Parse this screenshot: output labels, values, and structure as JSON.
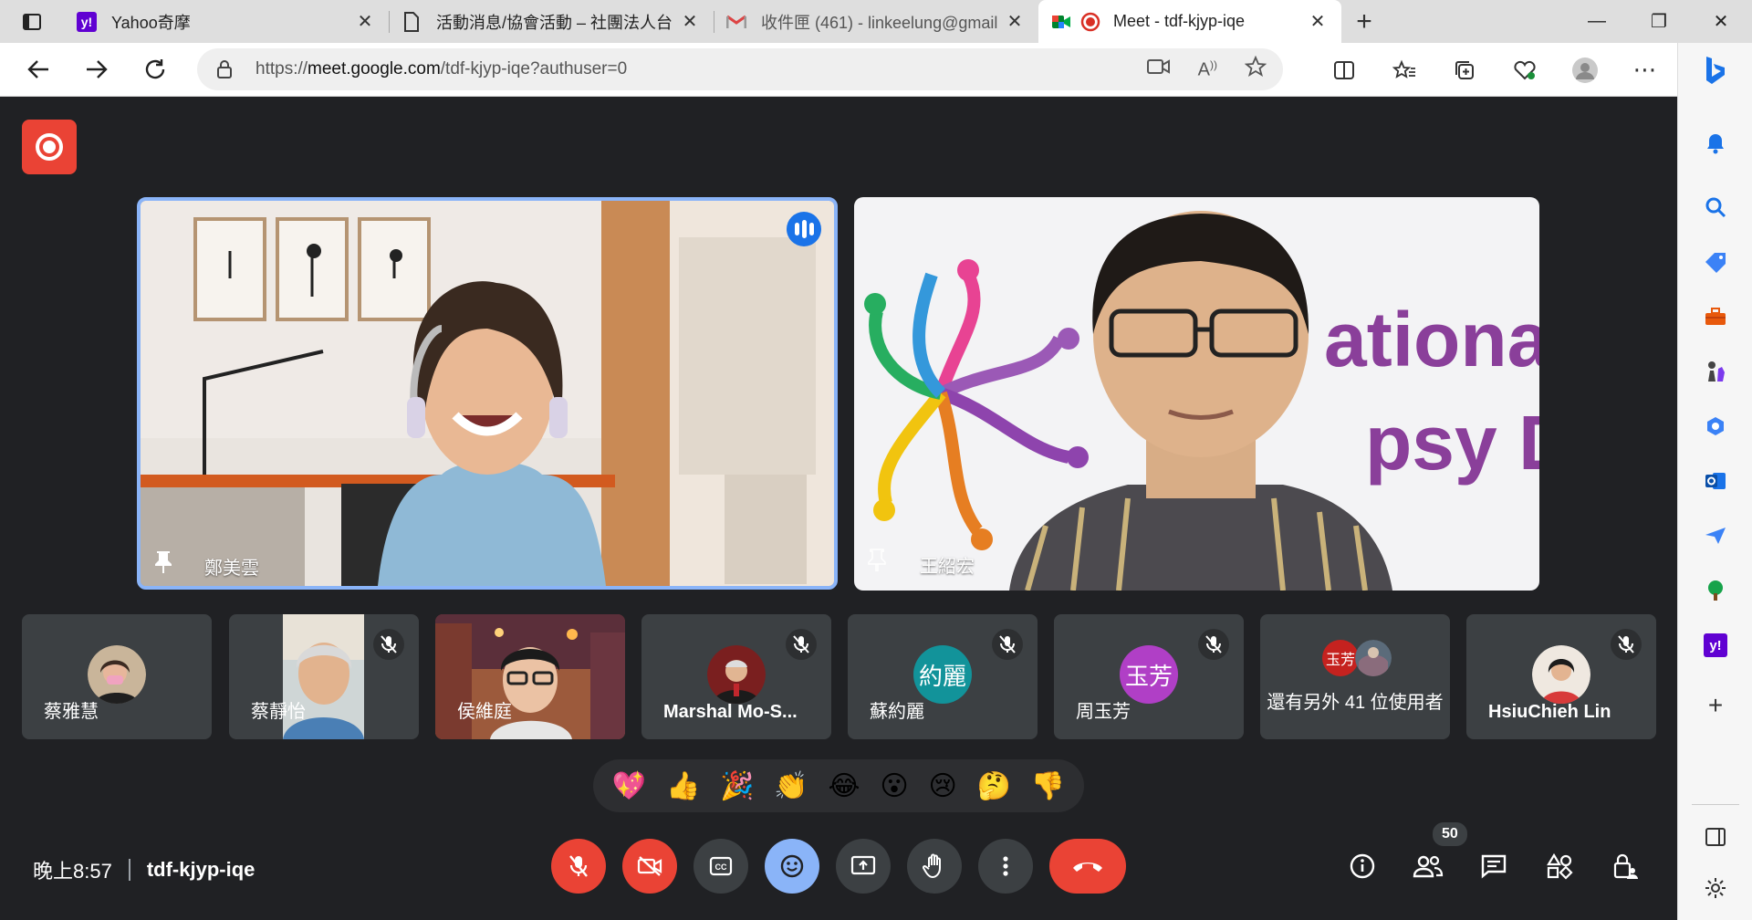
{
  "tabs": [
    {
      "title": "Yahoo奇摩",
      "favicon": "yahoo-icon"
    },
    {
      "title": "活動消息/協會活動 – 社團法人台",
      "favicon": "page-icon"
    },
    {
      "title": "收件匣 (461) - linkeelung@gmail",
      "favicon": "gmail-icon"
    },
    {
      "title": "Meet - tdf-kjyp-iqe",
      "favicon": "meet-icon",
      "active": true
    }
  ],
  "address": {
    "prefix": "https://",
    "host": "meet.google.com",
    "path": "/tdf-kjyp-iqe?authuser=0"
  },
  "meeting": {
    "time": "晚上8:57",
    "code": "tdf-kjyp-iqe",
    "participant_count": "50"
  },
  "main_tiles": [
    {
      "name": "鄭美雲",
      "speaking": true
    },
    {
      "name": "王紹宏",
      "speaking": false,
      "background_text_line1": "ational",
      "background_text_line2": "psy Da"
    }
  ],
  "small_tiles": [
    {
      "name": "蔡雅慧",
      "muted": false
    },
    {
      "name": "蔡靜怡",
      "muted": true
    },
    {
      "name": "侯維庭",
      "muted": false
    },
    {
      "name": "Marshal Mo-S...",
      "muted": true
    },
    {
      "name": "蘇約麗",
      "avatar_text": "約麗",
      "avatar_color": "#12939a",
      "muted": true
    },
    {
      "name": "周玉芳",
      "avatar_text": "玉芳",
      "avatar_color": "#b03fc6",
      "muted": true
    },
    {
      "name": "還有另外 41 位使用者",
      "avatar_text": "玉芳",
      "avatar_color": "#c5221f"
    },
    {
      "name": "HsiuChieh Lin",
      "muted": true
    }
  ],
  "reactions": [
    "💖",
    "👍",
    "🎉",
    "👏",
    "😂",
    "😮",
    "😢",
    "🤔",
    "👎"
  ],
  "colors": {
    "meet_bg": "#202124",
    "tile_bg": "#3c4043",
    "red": "#ea4335",
    "accent_blue": "#8ab4f8"
  }
}
